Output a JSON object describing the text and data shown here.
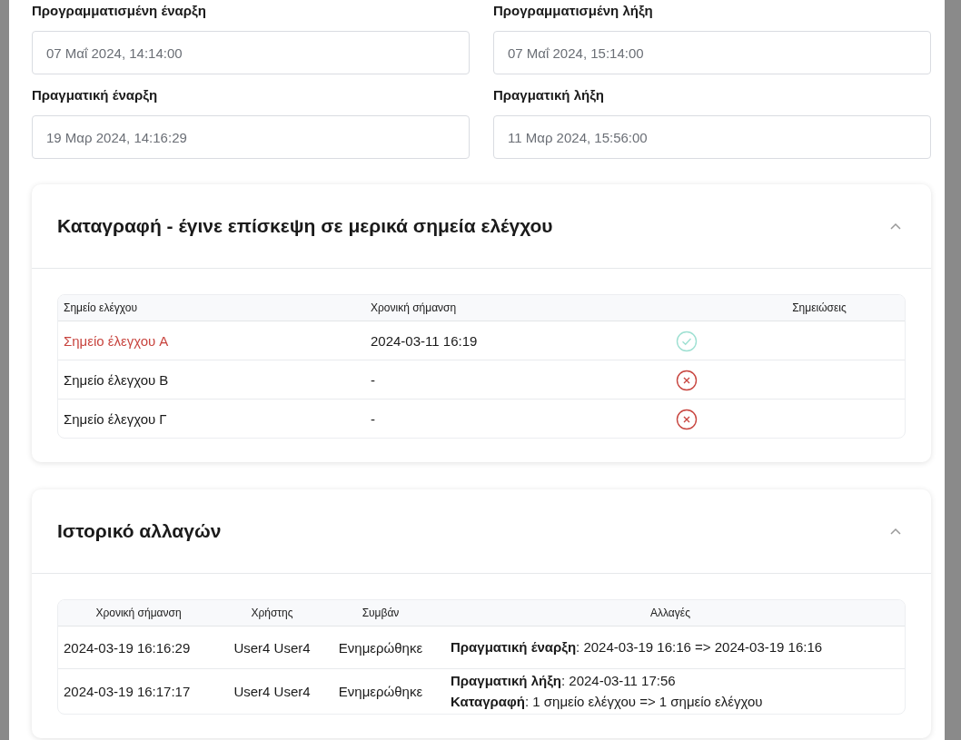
{
  "fields": [
    {
      "label": "Προγραμματισμένη έναρξη",
      "value": "07 Μαΐ 2024, 14:14:00"
    },
    {
      "label": "Προγραμματισμένη λήξη",
      "value": "07 Μαΐ 2024, 15:14:00"
    },
    {
      "label": "Πραγματική έναρξη",
      "value": "19 Μαρ 2024, 14:16:29"
    },
    {
      "label": "Πραγματική λήξη",
      "value": "11 Μαρ 2024, 15:56:00"
    }
  ],
  "checkpoints": {
    "title": "Καταγραφή - έγινε επίσκεψη σε μερικά σημεία ελέγχου",
    "expanded": true,
    "columns": [
      "Σημείο ελέγχου",
      "Χρονική σήμανση",
      "Σημειώσεις"
    ],
    "rows": [
      {
        "name": "Σημείο έλεγχου A",
        "highlighted": true,
        "time": "2024-03-11 16:19",
        "visited": true
      },
      {
        "name": "Σημείο έλεγχου B",
        "highlighted": false,
        "time": "-",
        "visited": false
      },
      {
        "name": "Σημείο έλεγχου Γ",
        "highlighted": false,
        "time": "-",
        "visited": false
      }
    ]
  },
  "history": {
    "title": "Ιστορικό αλλαγών",
    "expanded": true,
    "columns": [
      "Χρονική σήμανση",
      "Χρήστης",
      "Συμβάν",
      "Αλλαγές"
    ],
    "rows": [
      {
        "time": "2024-03-19 16:16:29",
        "user": "User4 User4",
        "event": "Ενημερώθηκε",
        "changes": [
          "**Πραγματική έναρξη**: 2024-03-19 16:16 => 2024-03-19 16:16"
        ]
      },
      {
        "time": "2024-03-19 16:17:17",
        "user": "User4 User4",
        "event": "Ενημερώθηκε",
        "changes": [
          "**Πραγματική λήξη**: 2024-03-11 17:56",
          "**Καταγραφή**: 1 σημείο ελέγχου => 1 σημείο ελέγχου"
        ]
      }
    ]
  }
}
